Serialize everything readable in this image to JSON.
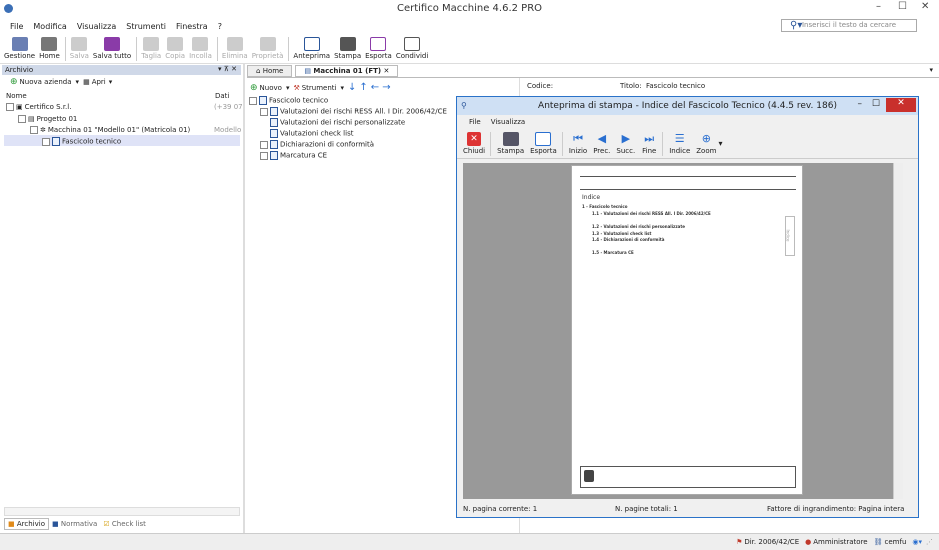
{
  "window": {
    "title": "Certifico Macchine 4.6.2 PRO",
    "controls": [
      "–",
      "☐",
      "✕"
    ]
  },
  "menu": [
    "File",
    "Modifica",
    "Visualizza",
    "Strumenti",
    "Finestra",
    "?"
  ],
  "search": {
    "placeholder": "Inserisci il testo da cercare",
    "icon": "search-icon"
  },
  "toolbar": {
    "items": [
      {
        "label": "Gestione",
        "icon": "calendar-icon",
        "enabled": true
      },
      {
        "label": "Home",
        "icon": "home-icon",
        "enabled": true
      },
      {
        "label": "Salva",
        "icon": "save-icon",
        "enabled": false
      },
      {
        "label": "Salva tutto",
        "icon": "save-all-icon",
        "enabled": true
      },
      {
        "label": "Taglia",
        "icon": "cut-icon",
        "enabled": false
      },
      {
        "label": "Copia",
        "icon": "copy-icon",
        "enabled": false
      },
      {
        "label": "Incolla",
        "icon": "paste-icon",
        "enabled": false
      },
      {
        "label": "Elimina",
        "icon": "delete-icon",
        "enabled": false
      },
      {
        "label": "Proprietà",
        "icon": "properties-icon",
        "enabled": false
      },
      {
        "label": "Anteprima",
        "icon": "preview-icon",
        "enabled": true
      },
      {
        "label": "Stampa",
        "icon": "print-icon",
        "enabled": true
      },
      {
        "label": "Esporta",
        "icon": "export-icon",
        "enabled": true
      },
      {
        "label": "Condividi",
        "icon": "share-icon",
        "enabled": true
      }
    ]
  },
  "archive": {
    "header": "Archivio",
    "new_company": "Nuova azienda",
    "open": "Apri",
    "columns": {
      "name": "Nome",
      "data": "Dati"
    },
    "tree": [
      {
        "label": "Certifico S.r.l.",
        "data": "(+39 07"
      },
      {
        "label": "Progetto 01",
        "data": ""
      },
      {
        "label": "Macchina 01 \"Modello 01\" (Matricola 01)",
        "data": "Modello"
      },
      {
        "label": "Fascicolo tecnico",
        "data": ""
      }
    ],
    "bottom_tabs": [
      "Archivio",
      "Normativa",
      "Check list"
    ]
  },
  "tabs": {
    "home": "Home",
    "active": "Macchina 01 (FT)"
  },
  "mid": {
    "new": "Nuovo",
    "tools": "Strumenti",
    "root": "Fascicolo tecnico",
    "items": [
      "Valutazioni dei rischi RESS All. I Dir. 2006/42/CE",
      "Valutazioni dei rischi personalizzate",
      "Valutazioni check list",
      "Dichiarazioni di conformità",
      "Marcatura CE"
    ]
  },
  "right_header": {
    "code_label": "Codice:",
    "title_label": "Titolo:",
    "title_value": "Fascicolo tecnico"
  },
  "preview": {
    "title": "Anteprima di stampa - Indice del Fascicolo Tecnico (4.4.5 rev. 186)",
    "menu": [
      "File",
      "Visualizza"
    ],
    "buttons": [
      {
        "label": "Chiudi",
        "icon": "close-icon"
      },
      {
        "label": "Stampa",
        "icon": "print-icon"
      },
      {
        "label": "Esporta",
        "icon": "export-icon"
      },
      {
        "label": "Inizio",
        "icon": "first-page-icon"
      },
      {
        "label": "Prec.",
        "icon": "prev-page-icon"
      },
      {
        "label": "Succ.",
        "icon": "next-page-icon"
      },
      {
        "label": "Fine",
        "icon": "last-page-icon"
      },
      {
        "label": "Indice",
        "icon": "index-icon"
      },
      {
        "label": "Zoom",
        "icon": "zoom-icon"
      }
    ],
    "page_heading": "Indice",
    "page_lines": [
      "1 - Fascicolo tecnico",
      "1.1 - Valutazioni dei rischi RESS All. I Dir. 2006/42/CE",
      "1.2 - Valutazioni dei rischi personalizzate",
      "1.3 - Valutazioni check list",
      "1.4 - Dichiarazioni di conformità",
      "1.5 - Marcatura CE"
    ],
    "side_tab": "Indice",
    "status": {
      "current": "N. pagina corrente: 1",
      "total": "N. pagine totali: 1",
      "zoom": "Fattore di ingrandimento: Pagina intera"
    }
  },
  "statusbar": {
    "directive": "Dir. 2006/42/CE",
    "user": "Amministratore",
    "link": "cemfu"
  }
}
